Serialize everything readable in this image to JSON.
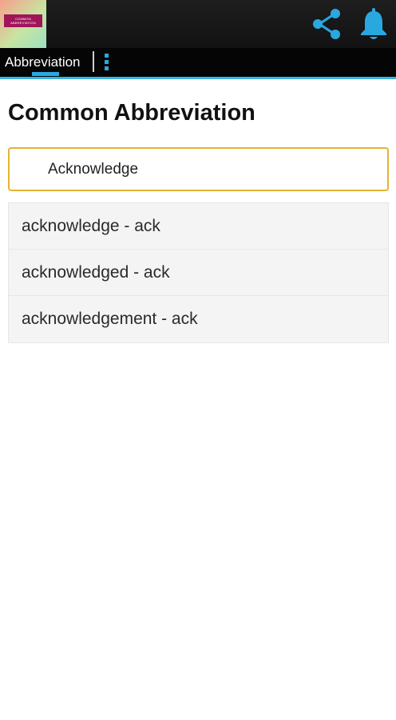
{
  "app_bar": {
    "logo_text": "COMMON ABBREVIATION",
    "logo_icon": "app-logo",
    "share_icon": "share-icon",
    "bell_icon": "bell-icon",
    "icon_color": "#29a8e0"
  },
  "tabs": {
    "active_label": "Abbreviation",
    "more_icon": "more-vert-icon",
    "accent_color": "#29a8e0"
  },
  "page": {
    "title": "Common Abbreviation"
  },
  "search": {
    "value": "Acknowledge",
    "border_color": "#e3b433"
  },
  "results": [
    {
      "text": "acknowledge - ack"
    },
    {
      "text": "acknowledged - ack"
    },
    {
      "text": "acknowledgement - ack"
    }
  ]
}
